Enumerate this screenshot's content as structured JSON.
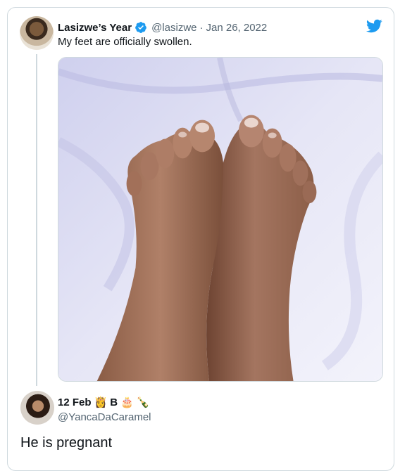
{
  "tweet": {
    "display_name": "Lasizwe’s Year",
    "verified": true,
    "handle": "@lasizwe",
    "separator": "·",
    "date": "Jan 26, 2022",
    "text": "My feet are officially swollen.",
    "media_alt": "Photo of two feet on white bed sheets"
  },
  "reply": {
    "display_name": "12 Feb",
    "name_suffix": "B",
    "emoji_1": "👸",
    "emoji_2": "🎂",
    "emoji_3": "🍾",
    "handle": "@YancaDaCaramel",
    "text": "He is pregnant"
  },
  "colors": {
    "twitter_blue": "#1d9bf0",
    "text_primary": "#0f1419",
    "text_secondary": "#536471",
    "border": "#cfd9de"
  },
  "icons": {
    "verified": "verified-badge-icon",
    "brand": "twitter-bird-icon"
  }
}
